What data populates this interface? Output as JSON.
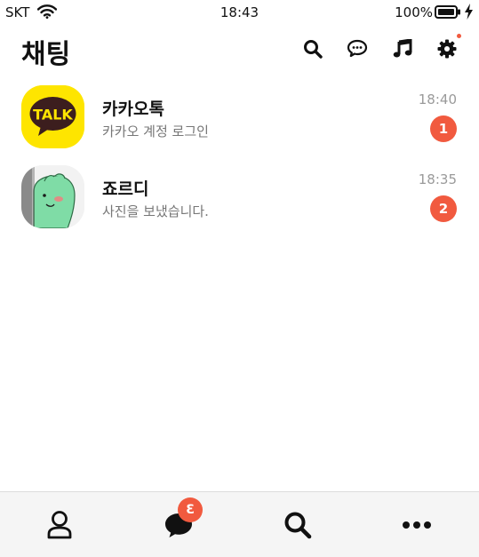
{
  "status_bar": {
    "carrier": "SKT",
    "time": "18:43",
    "battery": "100%",
    "icons": [
      "wifi-icon",
      "battery-icon",
      "charging-icon"
    ]
  },
  "header": {
    "title": "채팅",
    "icons": [
      "search-icon",
      "open-chat-icon",
      "music-icon",
      "gear-icon"
    ]
  },
  "chats": [
    {
      "name": "카카오톡",
      "preview": "카카오 계정 로그인",
      "time": "18:40",
      "unread": "1",
      "avatar_text": "TALK"
    },
    {
      "name": "죠르디",
      "preview": "사진을 보냈습니다.",
      "time": "18:35",
      "unread": "2"
    }
  ],
  "bottom_nav": {
    "items": [
      "friends-icon",
      "chats-icon",
      "search-icon",
      "more-icon"
    ],
    "chats_badge": "3"
  },
  "colors": {
    "badge": "#f15a3f",
    "kakao_yellow": "#fee500",
    "kakao_brown": "#3c1e1e",
    "nav_background": "#f5f5f5"
  }
}
